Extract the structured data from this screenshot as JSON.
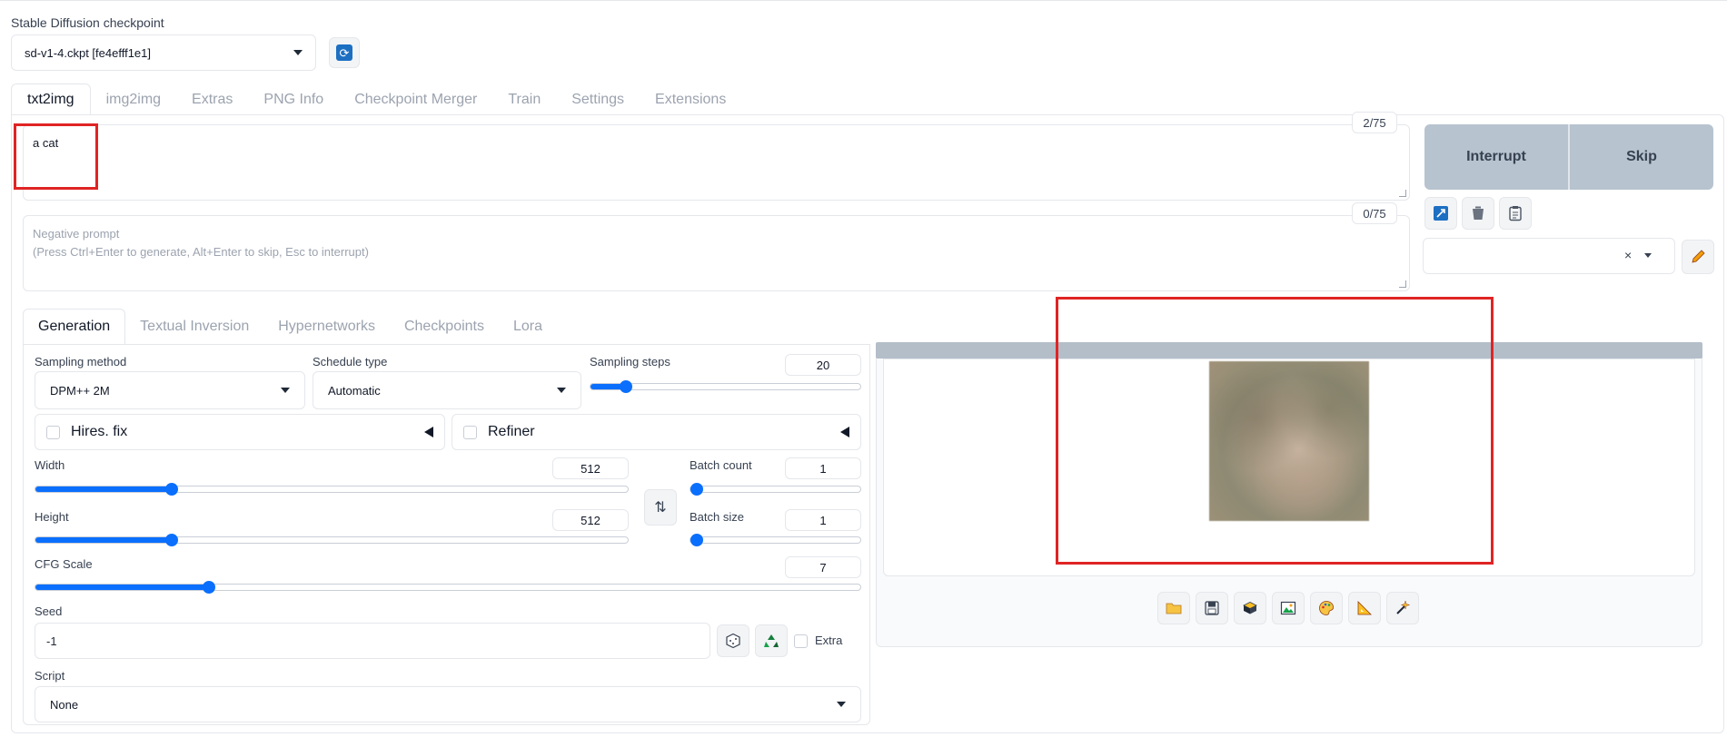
{
  "checkpoint": {
    "label": "Stable Diffusion checkpoint",
    "value": "sd-v1-4.ckpt [fe4efff1e1]"
  },
  "main_tabs": [
    "txt2img",
    "img2img",
    "Extras",
    "PNG Info",
    "Checkpoint Merger",
    "Train",
    "Settings",
    "Extensions"
  ],
  "prompt": {
    "value": "a cat",
    "counter": "2/75"
  },
  "negative_prompt": {
    "placeholder_line1": "Negative prompt",
    "placeholder_line2": "(Press Ctrl+Enter to generate, Alt+Enter to skip, Esc to interrupt)",
    "counter": "0/75"
  },
  "actions": {
    "interrupt": "Interrupt",
    "skip": "Skip"
  },
  "style_select": {
    "clear": "×"
  },
  "sub_tabs": [
    "Generation",
    "Textual Inversion",
    "Hypernetworks",
    "Checkpoints",
    "Lora"
  ],
  "generation": {
    "sampling_method": {
      "label": "Sampling method",
      "value": "DPM++ 2M"
    },
    "schedule_type": {
      "label": "Schedule type",
      "value": "Automatic"
    },
    "sampling_steps": {
      "label": "Sampling steps",
      "value": "20",
      "fraction": 0.13
    },
    "hires_fix": {
      "label": "Hires. fix"
    },
    "refiner": {
      "label": "Refiner"
    },
    "width": {
      "label": "Width",
      "value": "512",
      "fraction": 0.23
    },
    "height": {
      "label": "Height",
      "value": "512",
      "fraction": 0.23
    },
    "batch_count": {
      "label": "Batch count",
      "value": "1",
      "fraction": 0.0
    },
    "batch_size": {
      "label": "Batch size",
      "value": "1",
      "fraction": 0.0
    },
    "cfg_scale": {
      "label": "CFG Scale",
      "value": "7",
      "fraction": 0.21
    },
    "seed": {
      "label": "Seed",
      "value": "-1",
      "extra_label": "Extra"
    },
    "script": {
      "label": "Script",
      "value": "None"
    }
  },
  "output_tools": [
    "folder-icon",
    "save-icon",
    "zip-icon",
    "image-icon",
    "palette-icon",
    "ruler-icon",
    "sparkle-icon"
  ],
  "colors": {
    "accent": "#0b6ffd",
    "action_bg": "#b7c3cf",
    "highlight": "#e02424"
  }
}
